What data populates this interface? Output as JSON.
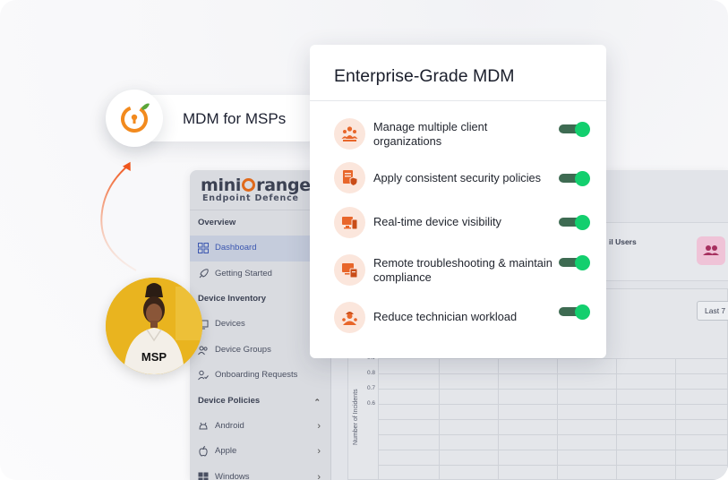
{
  "pill": {
    "label": "MDM for MSPs",
    "icon": "keyhole-leaf-logo-icon",
    "accent": "#f28a1e",
    "leaf_color": "#5aa63a"
  },
  "avatar": {
    "label": "MSP",
    "background": "#e9b41f"
  },
  "card": {
    "title": "Enterprise-Grade MDM",
    "features": [
      {
        "label": "Manage multiple client organizations",
        "icon": "people-group-icon",
        "enabled": true
      },
      {
        "label": "Apply consistent security policies",
        "icon": "document-shield-icon",
        "enabled": true
      },
      {
        "label": "Real-time device visibility",
        "icon": "devices-icon",
        "enabled": true
      },
      {
        "label": "Remote troubleshooting & maintain compliance",
        "icon": "remote-tools-icon",
        "enabled": true
      },
      {
        "label": "Reduce technician workload",
        "icon": "technician-icon",
        "enabled": true
      }
    ],
    "toggle_color": "#13cf6e",
    "icon_color": "#e8662a"
  },
  "dashboard": {
    "brand": "miniOrange",
    "brand_prefix": "mini",
    "brand_suffix": "range",
    "tagline": "Endpoint Defence",
    "sidebar": {
      "overview_heading": "Overview",
      "dashboard": "Dashboard",
      "getting_started": "Getting Started",
      "inventory_heading": "Device Inventory",
      "devices": "Devices",
      "device_groups": "Device Groups",
      "onboarding": "Onboarding Requests",
      "policies_heading": "Device Policies",
      "android": "Android",
      "apple": "Apple",
      "windows": "Windows"
    },
    "users_label": "il Users",
    "range_button": "Last 7",
    "y_axis_label": "Number of Incidents",
    "y_ticks": [
      "0.9",
      "0.8",
      "0.7",
      "0.6"
    ]
  }
}
